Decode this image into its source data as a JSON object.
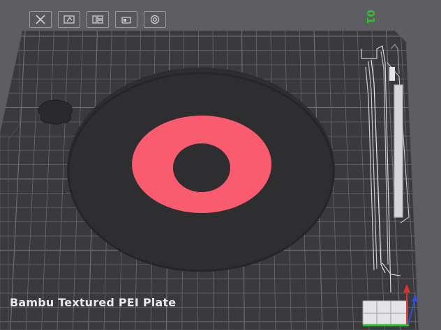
{
  "viewport": {
    "plate_label": "Bambu Textured PEI Plate",
    "plate_number": "01"
  },
  "toolbar": {
    "buttons": [
      {
        "name": "delete-plate-button",
        "icon": "close-icon"
      },
      {
        "name": "auto-orient-button",
        "icon": "orient-icon"
      },
      {
        "name": "arrange-button",
        "icon": "arrange-icon"
      },
      {
        "name": "lock-plate-button",
        "icon": "lock-icon"
      },
      {
        "name": "plate-settings-button",
        "icon": "gear-icon"
      }
    ]
  },
  "colors": {
    "background": "#5e5e62",
    "plate": "#3a3a3c",
    "grid": "#6a6a6e",
    "disc": "#2e2e30",
    "ring": "#f85c6e",
    "label": "#e8e8ea",
    "number": "#2ec22e",
    "axis_x": "#e03030",
    "axis_y": "#2ec22e",
    "axis_z": "#3050e0"
  }
}
